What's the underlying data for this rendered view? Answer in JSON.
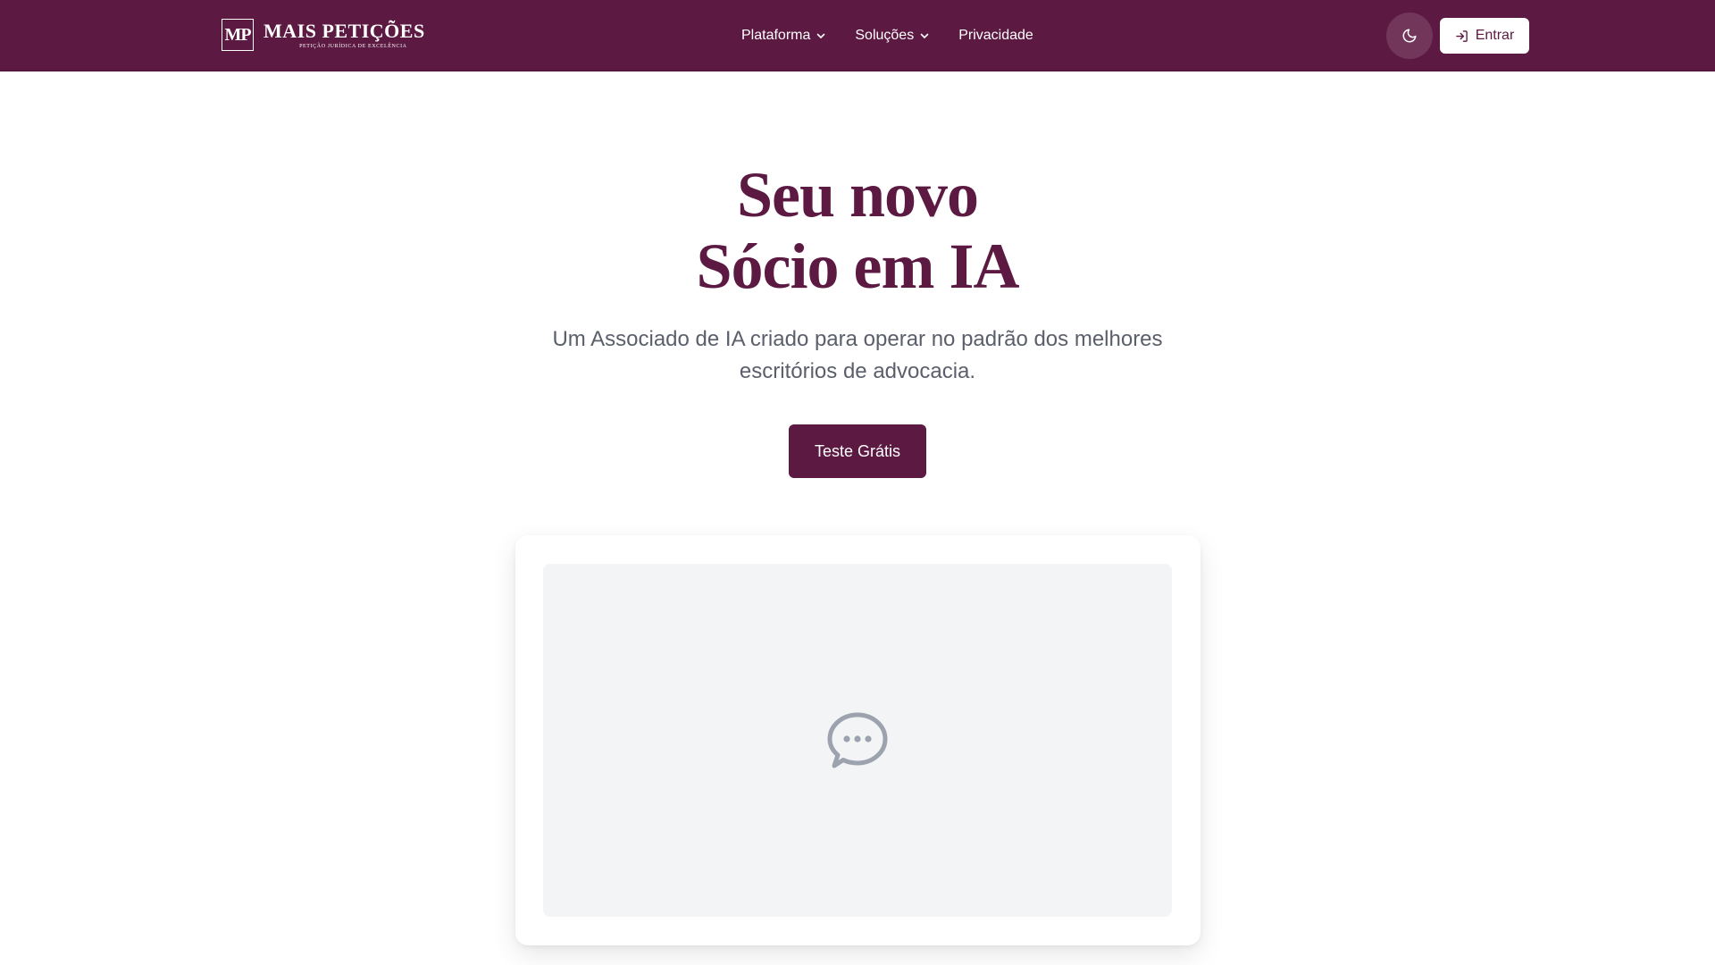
{
  "header": {
    "logo": {
      "monogram": "MP",
      "name": "MAIS PETIÇÕES",
      "tagline": "PETIÇÃO JURÍDICA DE EXCELÊNCIA"
    },
    "nav": [
      {
        "label": "Plataforma",
        "has_dropdown": true
      },
      {
        "label": "Soluções",
        "has_dropdown": true
      },
      {
        "label": "Privacidade",
        "has_dropdown": false
      }
    ],
    "theme_toggle_icon": "moon-icon",
    "login_label": "Entrar",
    "login_icon": "log-in-icon"
  },
  "hero": {
    "title_line1": "Seu novo",
    "title_line2": "Sócio em IA",
    "subtitle": "Um Associado de IA criado para operar no padrão dos melhores escritórios de advocacia.",
    "cta_label": "Teste Grátis"
  },
  "preview": {
    "icon": "message-circle-icon"
  },
  "colors": {
    "brand": "#5c1942",
    "theme_button_bg": "#73365b",
    "subtitle_text": "#5a5f6b",
    "preview_bg": "#f3f4f6",
    "preview_icon": "#9ca3af"
  }
}
